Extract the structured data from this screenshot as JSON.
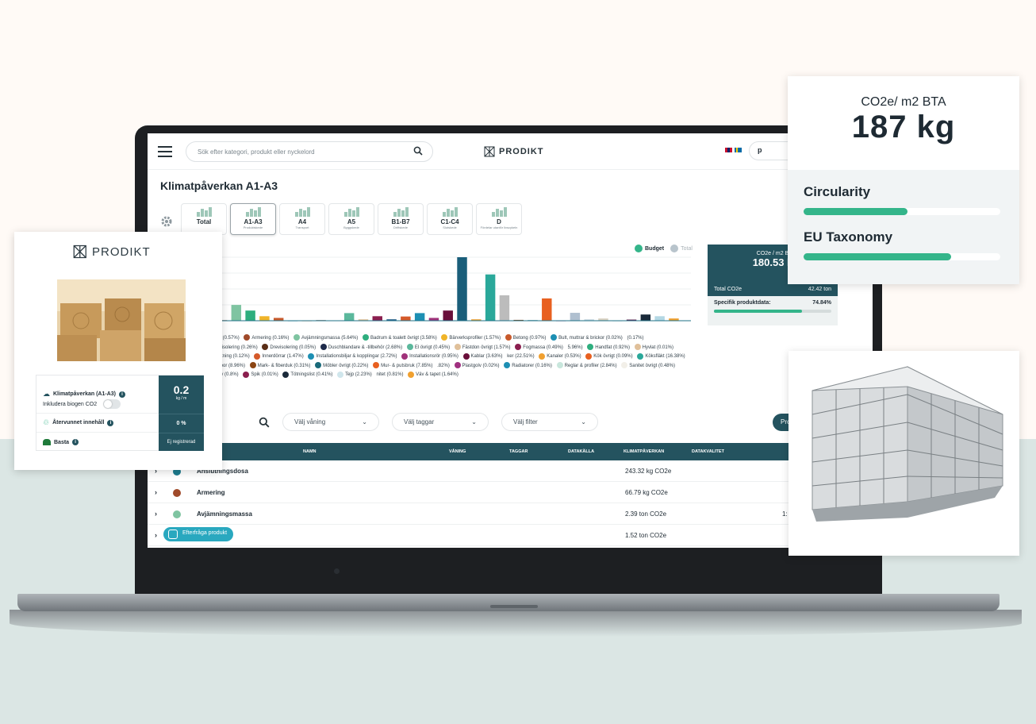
{
  "app": {
    "search_placeholder": "Sök efter kategori, produkt eller nyckelord",
    "logo_text": "PRODIKT",
    "user_initial": "p",
    "page_title": "Klimatpåverkan A1-A3"
  },
  "stages": [
    {
      "name": "Total",
      "sub": ""
    },
    {
      "name": "A1-A3",
      "sub": "Produktskede"
    },
    {
      "name": "A4",
      "sub": "Transport"
    },
    {
      "name": "A5",
      "sub": "Byggskede"
    },
    {
      "name": "B1-B7",
      "sub": "Driftskede"
    },
    {
      "name": "C1-C4",
      "sub": "Slutskede"
    },
    {
      "name": "D",
      "sub": "Fördelar utanför livscykeln"
    }
  ],
  "chart_legend": {
    "budget": "Budget",
    "total": "Total"
  },
  "chart_data": {
    "type": "bar",
    "values": [
      0.6,
      0.2,
      5.6,
      3.6,
      1.6,
      1.0,
      0.0,
      0.0,
      0.2,
      0.1,
      2.7,
      0.5,
      1.6,
      0.5,
      1.5,
      2.7,
      1.0,
      3.6,
      22.5,
      0.5,
      16.4,
      9.0,
      0.3,
      0.2,
      7.9,
      0.0,
      2.8,
      0.5,
      0.8,
      0.0,
      0.4,
      2.2,
      1.6,
      0.8
    ],
    "colors": [
      "#1d7c8f",
      "#a04a2a",
      "#7fc4a1",
      "#2eae7e",
      "#f0b429",
      "#c85a2c",
      "#1d8fb3",
      "#d87b3c",
      "#5a2e16",
      "#1e2a4a",
      "#5bb89c",
      "#e0c09a",
      "#8b1f4f",
      "#1f5a86",
      "#d55a2a",
      "#1d8fb3",
      "#a0327a",
      "#6a0f3a",
      "#1a5e7a",
      "#f0a030",
      "#2aa89a",
      "#bcbcbc",
      "#8b4513",
      "#1a6a7a",
      "#e86020",
      "#a03080",
      "#b0c0d0",
      "#c8d8e0",
      "#d8d0c0",
      "#a0c8d0",
      "#5a1a4a",
      "#1a2a3a",
      "#b4d8e4",
      "#f0a030"
    ]
  },
  "legend_items": [
    {
      "label": "dosa (0.57%)",
      "color": "#1d7c8f"
    },
    {
      "label": "Armering (0.16%)",
      "color": "#a04a2a"
    },
    {
      "label": "Avjämningsmassa (5.64%)",
      "color": "#7fc4a1"
    },
    {
      "label": "Badrum & toalett övrigt (3.58%)",
      "color": "#2eae7e"
    },
    {
      "label": "Bärverksprofiler (1.57%)",
      "color": "#f0b429"
    },
    {
      "label": "Betong (0.97%)",
      "color": "#c85a2c"
    },
    {
      "label": "Bult, muttrar & brickor (0.02%)",
      "color": "#1d8fb3"
    },
    {
      "label": "(0.17%)",
      "color": "#ffffff"
    },
    {
      "label": "Byggisolering (0.26%)",
      "color": "#d87b3c"
    },
    {
      "label": "Drevisolering (0.05%)",
      "color": "#5a2e16"
    },
    {
      "label": "Duschblandare & -tillbehör (2.68%)",
      "color": "#1e2a4a"
    },
    {
      "label": "El övrigt (0.45%)",
      "color": "#5bb89c"
    },
    {
      "label": "Fästdon övrigt (1.57%)",
      "color": "#e0c09a"
    },
    {
      "label": "Fogmassa (0.49%)",
      "color": "#8b1f4f"
    },
    {
      "label": "5.96%)",
      "color": "#ffffff"
    },
    {
      "label": "Handfat (0.92%)",
      "color": "#2eae7e"
    },
    {
      "label": "Hyvlat (0.01%)",
      "color": "#e0c09a"
    },
    {
      "label": "Infästning (0.12%)",
      "color": "#d87b3c"
    },
    {
      "label": "Innerdörrar (1.47%)",
      "color": "#d55a2a"
    },
    {
      "label": "Installationsbiljar & kopplingar (2.72%)",
      "color": "#1d8fb3"
    },
    {
      "label": "Installationsrör (0.95%)",
      "color": "#a0327a"
    },
    {
      "label": "Kablar (3.63%)",
      "color": "#6a0f3a"
    },
    {
      "label": "ker (22.51%)",
      "color": "#ffffff"
    },
    {
      "label": "Kanaler (0.53%)",
      "color": "#f0a030"
    },
    {
      "label": "Kök övrigt (0.09%)",
      "color": "#e86020"
    },
    {
      "label": "Köksfläkt (16.38%)",
      "color": "#2aa89a"
    },
    {
      "label": "Lampor (8.96%)",
      "color": "#bcbcbc"
    },
    {
      "label": "Mark- & fiberduk (0.31%)",
      "color": "#8b4513"
    },
    {
      "label": "Möbler övrigt (0.22%)",
      "color": "#1a6a7a"
    },
    {
      "label": "Mur- & putsbruk (7.85%)",
      "color": "#e86020"
    },
    {
      "label": ".82%)",
      "color": "#ffffff"
    },
    {
      "label": "Plastgolv (0.02%)",
      "color": "#a03080"
    },
    {
      "label": "Radiatorer (0.16%)",
      "color": "#1d8fb3"
    },
    {
      "label": "Reglar & profiler (2.84%)",
      "color": "#c8e6dc"
    },
    {
      "label": "Sanitet övrigt (0.48%)",
      "color": "#f2efe8"
    },
    {
      "label": "Skruv (0.8%)",
      "color": "#c8e6dc"
    },
    {
      "label": "Spik (0.01%)",
      "color": "#8b1f4f"
    },
    {
      "label": "Tötningslist (0.41%)",
      "color": "#1a2a3a"
    },
    {
      "label": "Tejp (2.23%)",
      "color": "#d0e6ec"
    },
    {
      "label": "nitet (0.81%)",
      "color": "#ffffff"
    },
    {
      "label": "Väv & tapet (1.64%)",
      "color": "#f0a030"
    }
  ],
  "summary": {
    "label": "CO2e / m2 B",
    "value": "180.53 k",
    "total_label": "Total CO2e",
    "total_value": "42.42 ton",
    "specific_label": "Specifik produktdata:",
    "specific_value": "74.84%",
    "specific_fraction": 0.7484
  },
  "filters": {
    "floor": "Välj våning",
    "tags": "Välj taggar",
    "filter": "Välj filter",
    "pro_button": "Pro"
  },
  "table": {
    "headers": [
      "NAMN",
      "VÅNING",
      "TAGGAR",
      "DATAKÄLLA",
      "KLIMATPÅVERKAN",
      "DATAKVALITET"
    ],
    "rows": [
      {
        "name": "Anslutningsdosa",
        "value": "243.32 kg CO2e",
        "extra": "",
        "color": "#1d7c8f"
      },
      {
        "name": "Armering",
        "value": "66.79 kg CO2e",
        "extra": "",
        "color": "#a04a2a"
      },
      {
        "name": "Avjämningsmassa",
        "value": "2.39 ton CO2e",
        "extra": "1:",
        "color": "#7fc4a1"
      },
      {
        "name": "lett övrigt",
        "value": "1.52 ton CO2e",
        "extra": "",
        "color": "#2eae7e"
      }
    ],
    "request_button": "Efterfråga produkt"
  },
  "product_card": {
    "logo_text": "PRODIKT",
    "climate_label": "Klimatpåverkan (A1-A3)",
    "climate_value": "0.2",
    "climate_unit": "kg / m",
    "biogen_label": "Inkludera biogen CO2",
    "recycled_label": "Återvunnet innehåll",
    "recycled_value": "0 %",
    "basta_label": "Basta",
    "basta_value": "Ej registrerad"
  },
  "kpi_card": {
    "label": "CO2e/ m2 BTA",
    "value": "187 kg",
    "circularity_label": "Circularity",
    "circularity_fraction": 0.53,
    "taxonomy_label": "EU Taxonomy",
    "taxonomy_fraction": 0.75
  }
}
